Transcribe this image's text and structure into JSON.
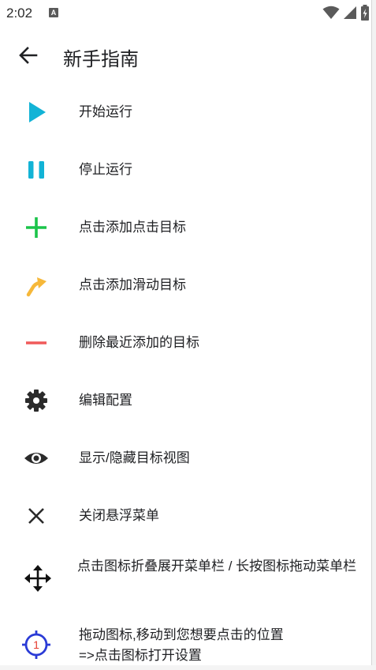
{
  "status_bar": {
    "time": "2:02",
    "notification_letter": "A"
  },
  "header": {
    "title": "新手指南"
  },
  "items": [
    {
      "label": "开始运行",
      "icon": "play-icon",
      "color": "#12b3d6"
    },
    {
      "label": "停止运行",
      "icon": "pause-icon",
      "color": "#12b3d6"
    },
    {
      "label": "点击添加点击目标",
      "icon": "plus-icon",
      "color": "#1bc44a"
    },
    {
      "label": "点击添加滑动目标",
      "icon": "swipe-arrow-icon",
      "color": "#f6b83a"
    },
    {
      "label": "删除最近添加的目标",
      "icon": "minus-icon",
      "color": "#f05a5a"
    },
    {
      "label": "编辑配置",
      "icon": "gear-icon",
      "color": "#2b2b2b"
    },
    {
      "label": "显示/隐藏目标视图",
      "icon": "eye-icon",
      "color": "#2b2b2b"
    },
    {
      "label": "关闭悬浮菜单",
      "icon": "close-icon",
      "color": "#2b2b2b"
    },
    {
      "label": "点击图标折叠展开菜单栏 / 长按图标拖动菜单栏",
      "icon": "move-icon",
      "color": "#111111"
    },
    {
      "label": "拖动图标,移动到您想要点击的位置\n=>点击图标打开设置",
      "icon": "target-icon",
      "color": "#2a3bd6",
      "badge": "1"
    }
  ]
}
